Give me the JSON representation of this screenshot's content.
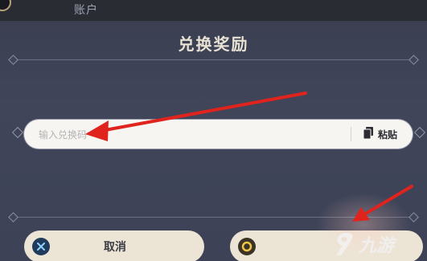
{
  "header": {
    "tab_label": "账户"
  },
  "dialog": {
    "title": "兑换奖励",
    "code_input": {
      "placeholder": "输入兑换码",
      "value": ""
    },
    "paste_button": {
      "label": "粘贴",
      "icon": "clipboard-icon"
    },
    "cancel_button": {
      "label": "取消",
      "icon": "close-circle-icon",
      "icon_color": "#1f3a5a"
    },
    "confirm_button": {
      "label": "",
      "icon": "circle-icon",
      "icon_color": "#3a3326"
    }
  },
  "annotations": {
    "arrow_color": "#e0231c"
  },
  "watermark": {
    "brand": "九游",
    "icon": "nine-game-logo-icon"
  }
}
